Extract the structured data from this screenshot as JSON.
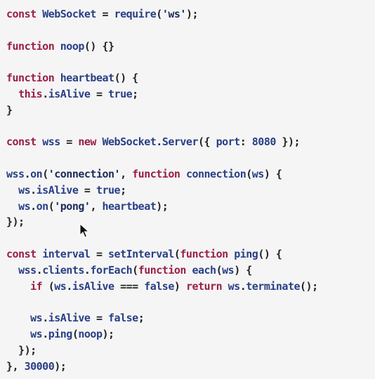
{
  "code": {
    "lines": [
      [
        [
          "k",
          "const "
        ],
        [
          "n",
          "WebSocket"
        ],
        [
          "p",
          " = "
        ],
        [
          "n",
          "require"
        ],
        [
          "p",
          "("
        ],
        [
          "s",
          "'ws'"
        ],
        [
          "p",
          ");"
        ]
      ],
      [],
      [
        [
          "k",
          "function "
        ],
        [
          "n",
          "noop"
        ],
        [
          "p",
          "() {}"
        ]
      ],
      [],
      [
        [
          "k",
          "function "
        ],
        [
          "n",
          "heartbeat"
        ],
        [
          "p",
          "() {"
        ]
      ],
      [
        [
          "p",
          "  "
        ],
        [
          "k",
          "this"
        ],
        [
          "p",
          "."
        ],
        [
          "n",
          "isAlive"
        ],
        [
          "p",
          " = "
        ],
        [
          "b",
          "true"
        ],
        [
          "p",
          ";"
        ]
      ],
      [
        [
          "p",
          "}"
        ]
      ],
      [],
      [
        [
          "k",
          "const "
        ],
        [
          "n",
          "wss"
        ],
        [
          "p",
          " = "
        ],
        [
          "k",
          "new "
        ],
        [
          "n",
          "WebSocket"
        ],
        [
          "p",
          "."
        ],
        [
          "n",
          "Server"
        ],
        [
          "p",
          "({ "
        ],
        [
          "n",
          "port"
        ],
        [
          "p",
          ": "
        ],
        [
          "b",
          "8080"
        ],
        [
          "p",
          " });"
        ]
      ],
      [],
      [
        [
          "n",
          "wss"
        ],
        [
          "p",
          "."
        ],
        [
          "n",
          "on"
        ],
        [
          "p",
          "("
        ],
        [
          "s",
          "'connection'"
        ],
        [
          "p",
          ", "
        ],
        [
          "k",
          "function "
        ],
        [
          "n",
          "connection"
        ],
        [
          "p",
          "("
        ],
        [
          "n",
          "ws"
        ],
        [
          "p",
          ") {"
        ]
      ],
      [
        [
          "p",
          "  "
        ],
        [
          "n",
          "ws"
        ],
        [
          "p",
          "."
        ],
        [
          "n",
          "isAlive"
        ],
        [
          "p",
          " = "
        ],
        [
          "b",
          "true"
        ],
        [
          "p",
          ";"
        ]
      ],
      [
        [
          "p",
          "  "
        ],
        [
          "n",
          "ws"
        ],
        [
          "p",
          "."
        ],
        [
          "n",
          "on"
        ],
        [
          "p",
          "("
        ],
        [
          "s",
          "'pong'"
        ],
        [
          "p",
          ", "
        ],
        [
          "n",
          "heartbeat"
        ],
        [
          "p",
          ");"
        ]
      ],
      [
        [
          "p",
          "});"
        ]
      ],
      [],
      [
        [
          "k",
          "const "
        ],
        [
          "n",
          "interval"
        ],
        [
          "p",
          " = "
        ],
        [
          "n",
          "setInterval"
        ],
        [
          "p",
          "("
        ],
        [
          "k",
          "function "
        ],
        [
          "n",
          "ping"
        ],
        [
          "p",
          "() {"
        ]
      ],
      [
        [
          "p",
          "  "
        ],
        [
          "n",
          "wss"
        ],
        [
          "p",
          "."
        ],
        [
          "n",
          "clients"
        ],
        [
          "p",
          "."
        ],
        [
          "n",
          "forEach"
        ],
        [
          "p",
          "("
        ],
        [
          "k",
          "function "
        ],
        [
          "n",
          "each"
        ],
        [
          "p",
          "("
        ],
        [
          "n",
          "ws"
        ],
        [
          "p",
          ") {"
        ]
      ],
      [
        [
          "p",
          "    "
        ],
        [
          "k",
          "if "
        ],
        [
          "p",
          "("
        ],
        [
          "n",
          "ws"
        ],
        [
          "p",
          "."
        ],
        [
          "n",
          "isAlive"
        ],
        [
          "p",
          " === "
        ],
        [
          "b",
          "false"
        ],
        [
          "p",
          ") "
        ],
        [
          "k",
          "return "
        ],
        [
          "n",
          "ws"
        ],
        [
          "p",
          "."
        ],
        [
          "n",
          "terminate"
        ],
        [
          "p",
          "();"
        ]
      ],
      [],
      [
        [
          "p",
          "    "
        ],
        [
          "n",
          "ws"
        ],
        [
          "p",
          "."
        ],
        [
          "n",
          "isAlive"
        ],
        [
          "p",
          " = "
        ],
        [
          "b",
          "false"
        ],
        [
          "p",
          ";"
        ]
      ],
      [
        [
          "p",
          "    "
        ],
        [
          "n",
          "ws"
        ],
        [
          "p",
          "."
        ],
        [
          "n",
          "ping"
        ],
        [
          "p",
          "("
        ],
        [
          "n",
          "noop"
        ],
        [
          "p",
          ");"
        ]
      ],
      [
        [
          "p",
          "  });"
        ]
      ],
      [
        [
          "p",
          "}, "
        ],
        [
          "b",
          "30000"
        ],
        [
          "p",
          ");"
        ]
      ]
    ]
  },
  "cursor": {
    "icon": "arrow-pointer-icon"
  }
}
